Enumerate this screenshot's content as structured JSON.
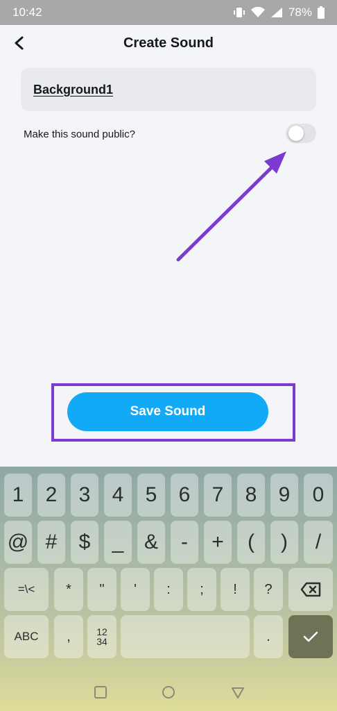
{
  "status": {
    "time": "10:42",
    "battery": "78%"
  },
  "header": {
    "title": "Create Sound"
  },
  "form": {
    "sound_name": "Background1",
    "public_label": "Make this sound public?",
    "public_enabled": false
  },
  "actions": {
    "save_label": "Save Sound"
  },
  "keyboard": {
    "row1": [
      "1",
      "2",
      "3",
      "4",
      "5",
      "6",
      "7",
      "8",
      "9",
      "0"
    ],
    "row2": [
      "@",
      "#",
      "$",
      "_",
      "&",
      "-",
      "+",
      "(",
      ")",
      "/"
    ],
    "row3": [
      "=\\<",
      "*",
      "\"",
      "'",
      ":",
      ";",
      "!",
      "?"
    ],
    "abc": "ABC",
    "comma": ",",
    "numpad_top": "12",
    "numpad_bottom": "34",
    "period": "."
  },
  "colors": {
    "accent": "#12aaf6",
    "annotation": "#7b3bd1",
    "enter_key": "#6f7355"
  }
}
